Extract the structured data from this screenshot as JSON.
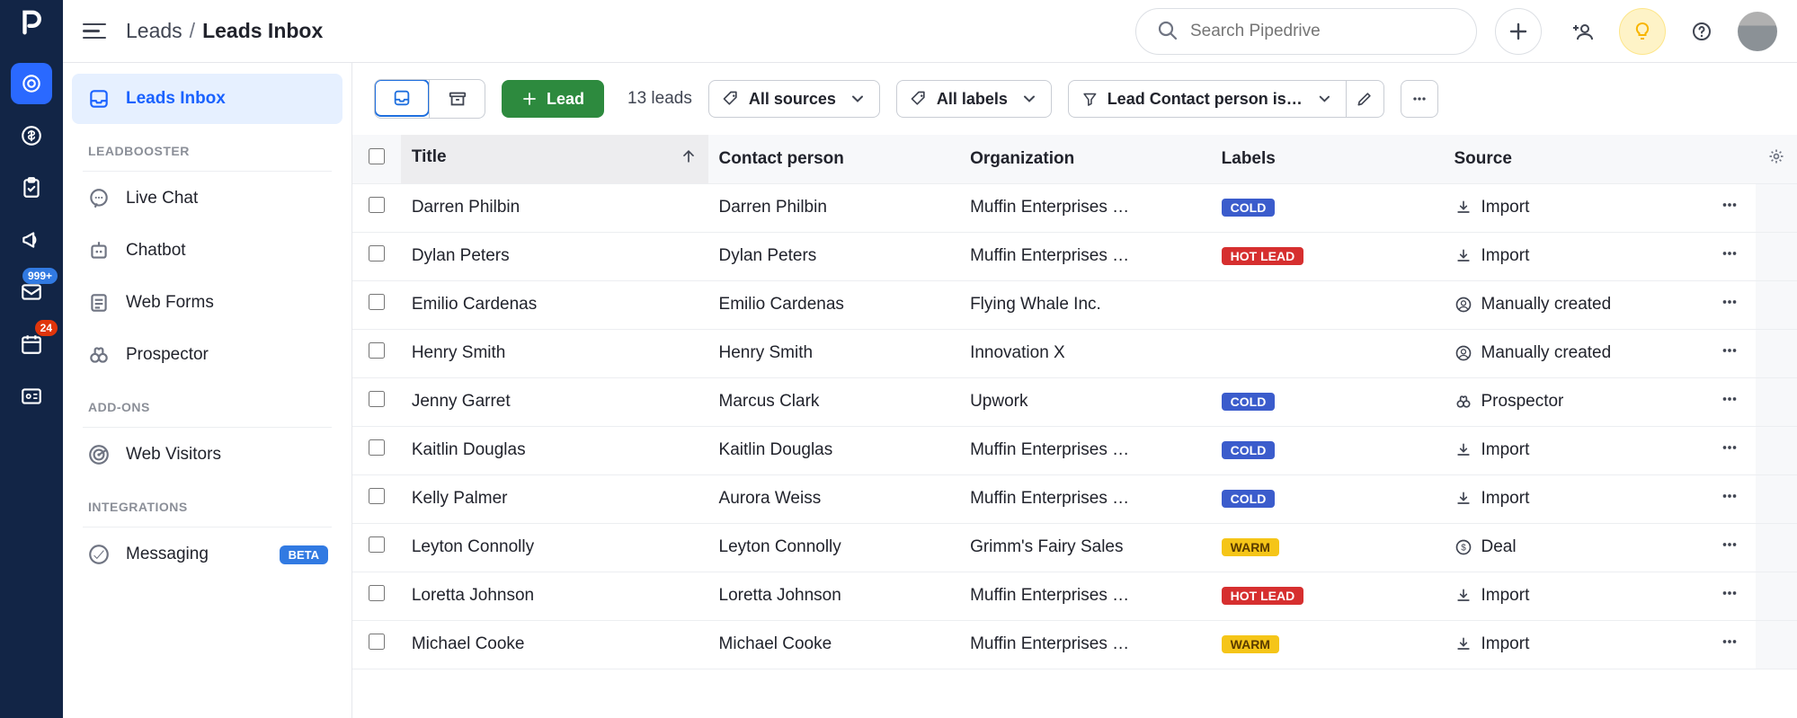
{
  "breadcrumb": {
    "parent": "Leads",
    "sep": "/",
    "current": "Leads Inbox"
  },
  "search": {
    "placeholder": "Search Pipedrive"
  },
  "nav": {
    "badges": {
      "campaigns": "999+",
      "activities": "24"
    }
  },
  "sidebar": {
    "inboxLabel": "Leads Inbox",
    "headers": {
      "leadbooster": "LEADBOOSTER",
      "addons": "ADD-ONS",
      "integrations": "INTEGRATIONS"
    },
    "items": {
      "liveChat": "Live Chat",
      "chatbot": "Chatbot",
      "webForms": "Web Forms",
      "prospector": "Prospector",
      "webVisitors": "Web Visitors",
      "messaging": "Messaging"
    },
    "betaLabel": "BETA"
  },
  "toolbar": {
    "addLeadLabel": "Lead",
    "countText": "13 leads",
    "sourcesLabel": "All sources",
    "labelsLabel": "All labels",
    "filterLabel": "Lead Contact person is n…"
  },
  "columns": {
    "title": "Title",
    "contact": "Contact person",
    "org": "Organization",
    "labels": "Labels",
    "source": "Source"
  },
  "labelNames": {
    "cold": "COLD",
    "hot": "HOT LEAD",
    "warm": "WARM"
  },
  "sourceNames": {
    "import": "Import",
    "manual": "Manually created",
    "prospector": "Prospector",
    "deal": "Deal"
  },
  "rows": [
    {
      "title": "Darren Philbin",
      "contact": "Darren Philbin",
      "org": "Muffin Enterprises …",
      "label": "cold",
      "source": "import"
    },
    {
      "title": "Dylan Peters",
      "contact": "Dylan Peters",
      "org": "Muffin Enterprises …",
      "label": "hot",
      "source": "import"
    },
    {
      "title": "Emilio Cardenas",
      "contact": "Emilio Cardenas",
      "org": "Flying Whale Inc.",
      "label": "",
      "source": "manual"
    },
    {
      "title": "Henry Smith",
      "contact": "Henry Smith",
      "org": "Innovation X",
      "label": "",
      "source": "manual"
    },
    {
      "title": "Jenny Garret",
      "contact": "Marcus Clark",
      "org": "Upwork",
      "label": "cold",
      "source": "prospector"
    },
    {
      "title": "Kaitlin Douglas",
      "contact": "Kaitlin Douglas",
      "org": "Muffin Enterprises …",
      "label": "cold",
      "source": "import"
    },
    {
      "title": "Kelly Palmer",
      "contact": "Aurora Weiss",
      "org": "Muffin Enterprises …",
      "label": "cold",
      "source": "import"
    },
    {
      "title": "Leyton Connolly",
      "contact": "Leyton Connolly",
      "org": "Grimm's Fairy Sales",
      "label": "warm",
      "source": "deal"
    },
    {
      "title": "Loretta Johnson",
      "contact": "Loretta Johnson",
      "org": "Muffin Enterprises …",
      "label": "hot",
      "source": "import"
    },
    {
      "title": "Michael Cooke",
      "contact": "Michael Cooke",
      "org": "Muffin Enterprises …",
      "label": "warm",
      "source": "import"
    }
  ]
}
